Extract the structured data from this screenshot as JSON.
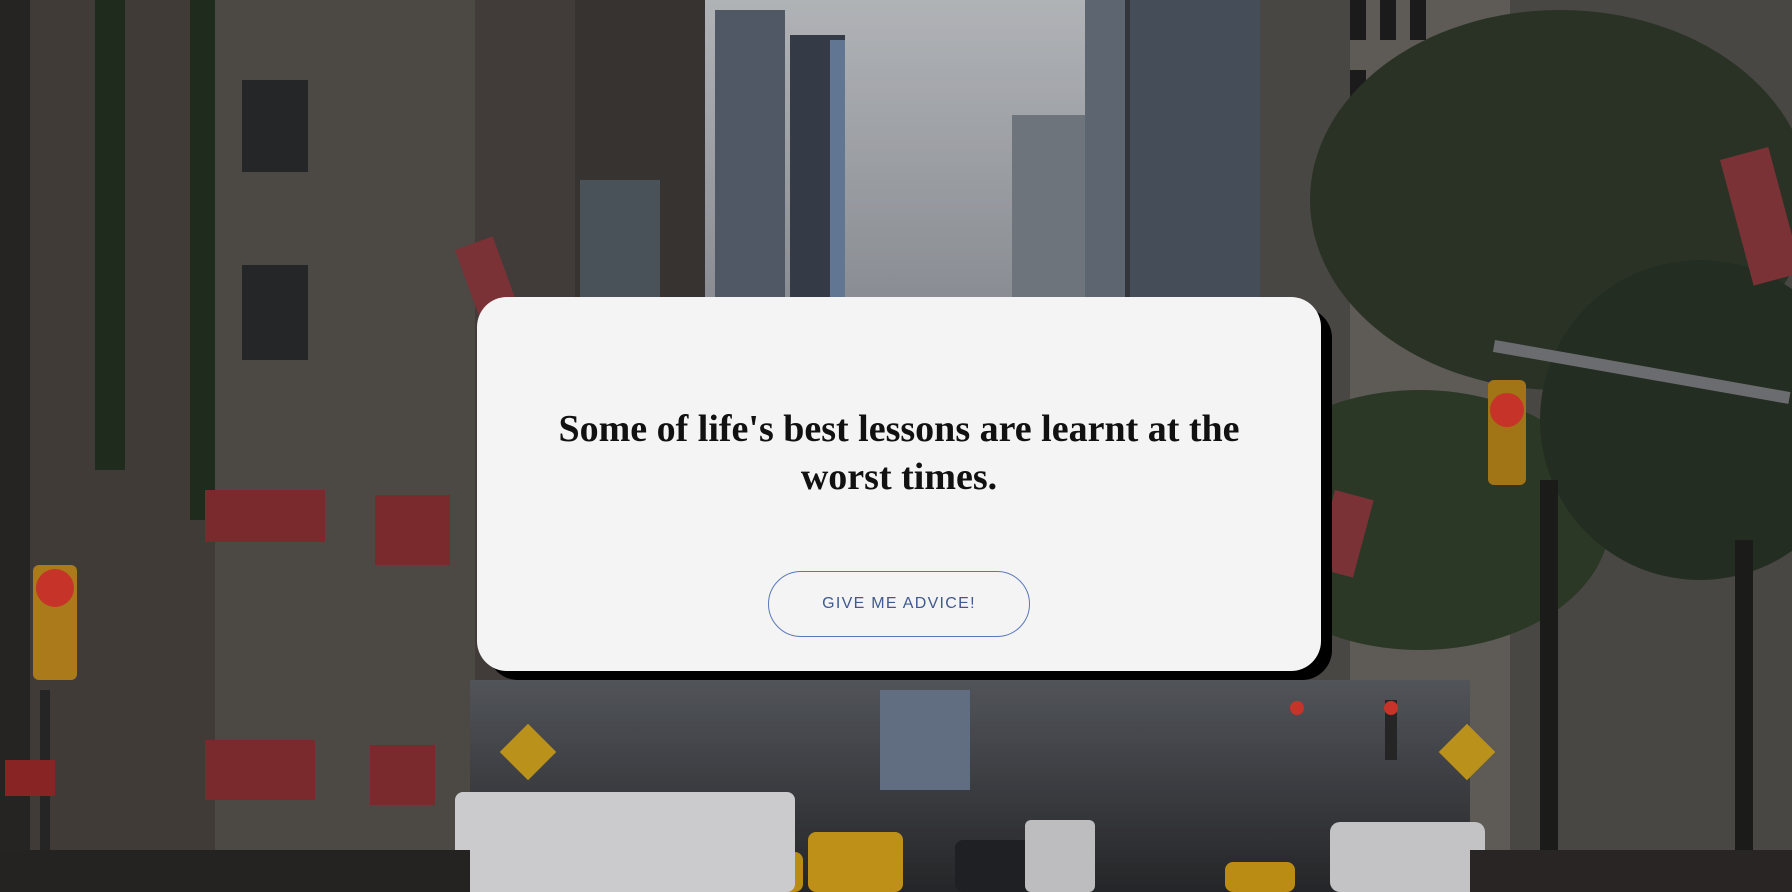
{
  "background": {
    "description_icon": "city-street-photo",
    "sky_color": "#b9bcc1",
    "building_color": "#4a4743",
    "tree_color": "#2f3a2a",
    "taxi_color": "#d4a017",
    "traffic_light_color": "#e23b2e"
  },
  "card": {
    "quote": "Some of life's best lessons are learnt at the worst times.",
    "button_label": "GIVE ME ADVICE!",
    "background_color": "#f4f4f4",
    "shadow_color": "#000000",
    "button_border_color": "#5a78b8",
    "button_text_color": "#3f5a8e"
  }
}
